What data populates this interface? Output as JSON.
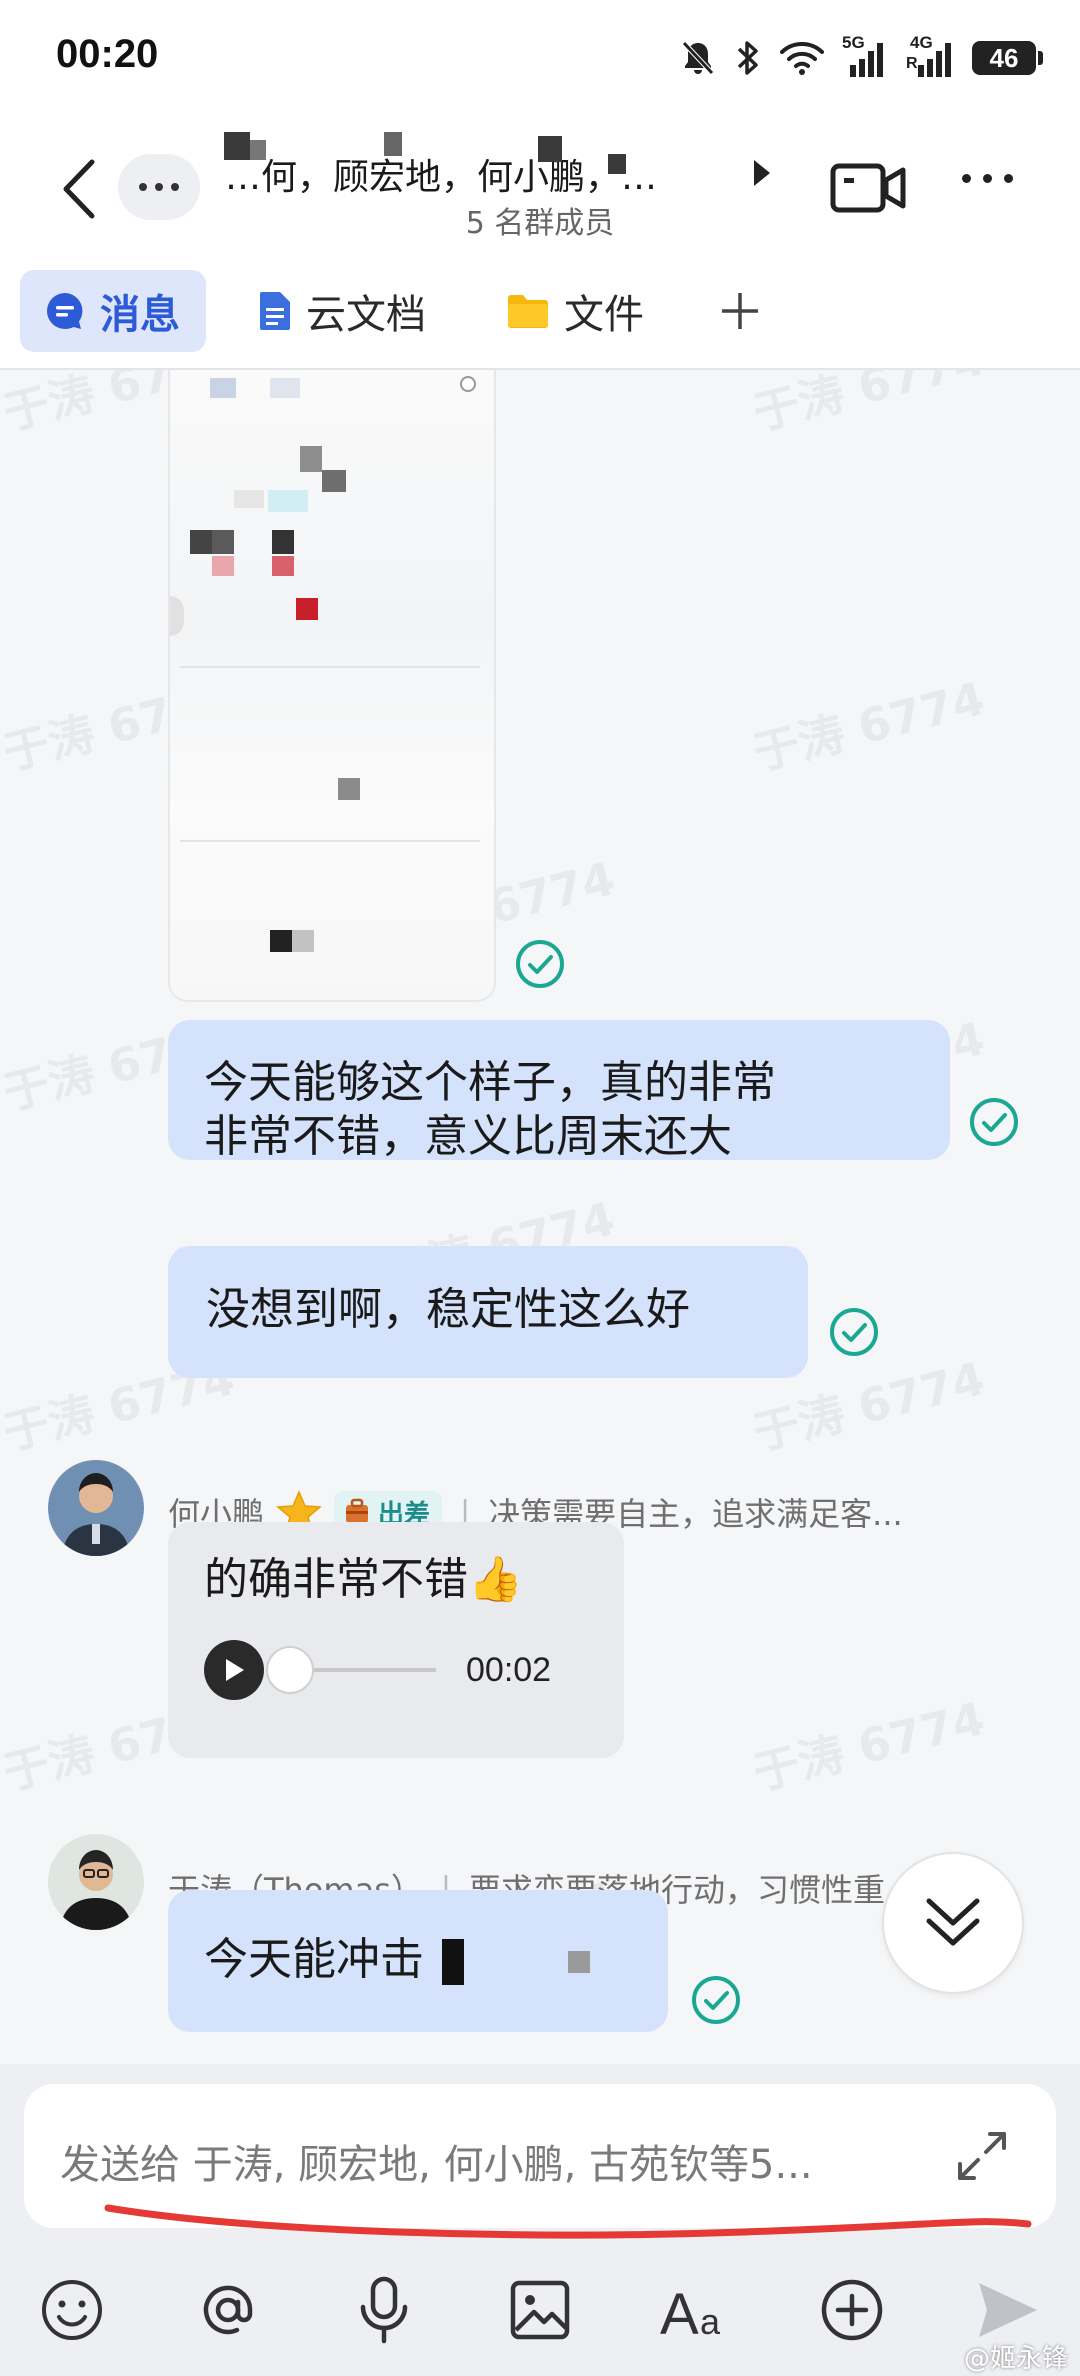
{
  "status_bar": {
    "time": "00:20",
    "battery": "46",
    "signal1_label": "5G",
    "signal2_label": "4G"
  },
  "header": {
    "title": "…何，顾宏地，何小鹏，…",
    "subtitle": "5 名群成员"
  },
  "tabs": [
    {
      "label": "消息",
      "icon": "chat-bubble-icon",
      "active": true
    },
    {
      "label": "云文档",
      "icon": "document-icon",
      "active": false
    },
    {
      "label": "文件",
      "icon": "folder-icon",
      "active": false
    }
  ],
  "messages": {
    "msg1": "今天能够这个样子，真的非常\n非常不错，意义比周末还大",
    "msg2": "没想到啊，稳定性这么好",
    "sender2": {
      "name": "何小鹏",
      "badge": "出差",
      "signature": "决策需要自主，追求满足客..."
    },
    "msg3": "的确非常不错👍",
    "voice_duration": "00:02",
    "sender3": {
      "name": "于涛（Thomas）",
      "signature": "要求变要落地行动，习惯性重"
    },
    "msg4": "今天能冲击"
  },
  "watermark": "于涛 6774",
  "composer": {
    "placeholder": "发送给 于涛, 顾宏地, 何小鹏, 古苑钦等5..."
  },
  "credit": "@姬永锋",
  "colors": {
    "accent": "#2d5bd7",
    "mine_bubble": "#d5e2fb",
    "other_bubble": "#e9eaed",
    "read_check": "#1aa893",
    "annotation_red": "#e53935"
  }
}
